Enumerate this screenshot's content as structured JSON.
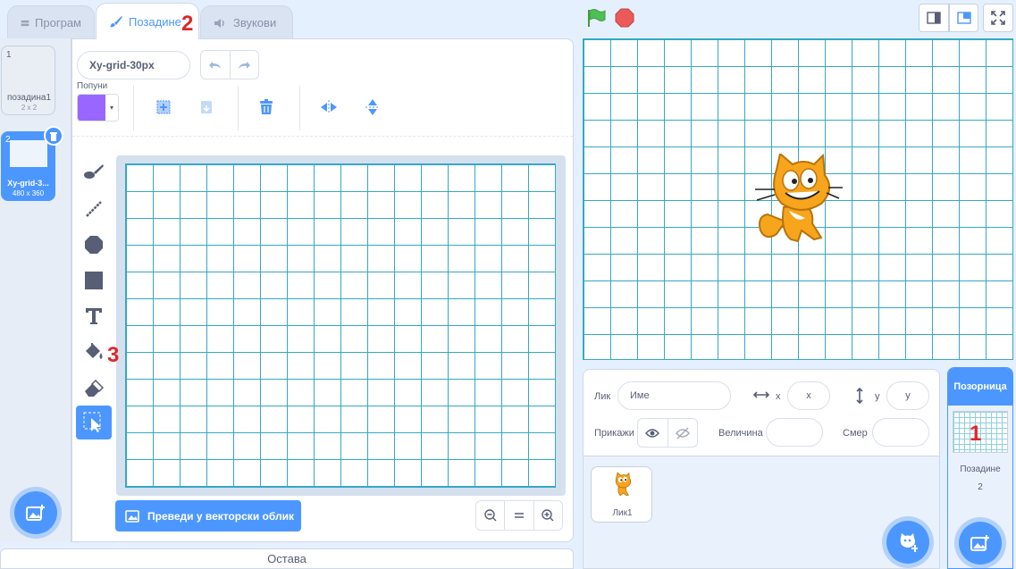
{
  "tabs": [
    {
      "label": "Програм",
      "icon": "code-icon"
    },
    {
      "label": "Позадине",
      "icon": "brush-icon"
    },
    {
      "label": "Звукови",
      "icon": "speaker-icon"
    }
  ],
  "annotations": {
    "mark1": "1",
    "mark2": "2",
    "mark3": "3"
  },
  "costumes": [
    {
      "number": "1",
      "name": "позадина1",
      "size": "2 x 2"
    },
    {
      "number": "2",
      "name": "Xy-grid-3...",
      "size": "480 x 360"
    }
  ],
  "editor": {
    "costume_name": "Xy-grid-30px",
    "fill_label": "Попуни",
    "fill_color": "#9966ff",
    "convert_button": "Преведи у векторски облик"
  },
  "backpack": {
    "label": "Остава"
  },
  "sprite_info": {
    "sprite_label": "Лик",
    "sprite_placeholder": "Име",
    "x_label": "x",
    "x_placeholder": "x",
    "y_label": "y",
    "y_placeholder": "y",
    "show_label": "Прикажи",
    "size_label": "Величина",
    "direction_label": "Смер"
  },
  "sprites": [
    {
      "name": "Лик1"
    }
  ],
  "stage_panel": {
    "title": "Позорница",
    "backdrops_label": "Позадине",
    "backdrops_count": "2"
  },
  "colors": {
    "accent": "#4c97ff",
    "grid": "#35a8c4",
    "annotation": "#e0262b"
  }
}
